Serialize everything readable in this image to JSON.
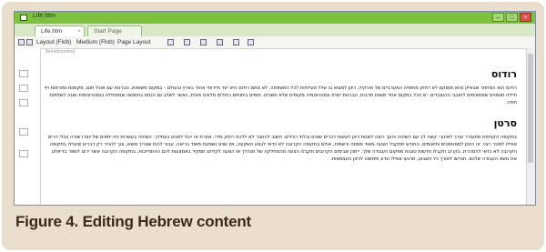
{
  "window": {
    "title": "Life.htm",
    "controls": {
      "minimize": "–",
      "maximize": "□",
      "close": "×"
    }
  },
  "tabs": [
    {
      "label": "Life.htm",
      "close": "×"
    },
    {
      "label": "Start Page"
    }
  ],
  "toolbar": {
    "layout": "Layout (Flob)",
    "size": "Medium (Flob)",
    "page_layout": "Page Layout"
  },
  "breadcrumb": "[breadcrumbs]",
  "document": {
    "heading1": "רודוס",
    "para1": "רודוס הוא המחוזר שבאייון והוא ממוקם לא רחוק מחופיה המערביים של טורקיה. כיוון למצוא בו שלל פעילויות לכל המשפחה. לא סתם רודוס היא יעד תיירותי אהוד בארץ ובעולם - במקום משופות, טברנות עם אוכל חום, מקומות ומורמות ויוי חיילה תוסטים שמתאימים לחובבי ההעובדים. יש הכל במקום אחד משנת תרבות, טברנות יוונית וגסטרונומיה מקומית שלא תשכחו. חופים ביתוחים כחולים מלווים ויוונית, נאשר לשלב גם הנחת בחופשה שמתחילה בגסטרונומית ושנה לשלמות חוויה.",
    "heading2": "סרטן",
    "para2": "בתקופה הקודמת מתעורר עורך לאינוך: קשה לך עם השיטה והעך רוצה לשנות כיוון לעשות דברים שונים ובלתי רגילים. חשוב להתבר לא ללכת רחוק מידי, אחרת זה יכול לפגוע בעתידך. השיטה בעשרות הזו יחסים של יוצרו שורה ובולי הרים אפילו למטר רצוי. זה הזמן לסמטפטים ותיאומים. החודש תתקבל הצעה מאוד מפתה ורשמית, אולם בתקופה הקרובה לא כדאי לבצע השקעה, אין שוים נשמעת מאוד בריאה, עבור לכות שצריך מוצא, צוך להכיר רק דברים שיובילו בתקופה הקרובה לא כדאי להמהרת. בקרוב תקבלו חדשות טובות מפקום העבודה שלך, ייתכן שבימים הקרובים תקבלו הצעה מהמחלקה של מנהלך או הצעה לקידום תפקיד באמצעות לכם ההתחייבות, בתקופה הקרובה אשר ירצו לשפר בדיאלוג את נושא העבודה שלכם. תנרשו לאורך כל השבוע, תרגעו אפילו ונדע תימשכו לכיוון העצמאות."
  },
  "caption": "Figure 4. Editing Hebrew content",
  "colors": {
    "titlebar": "#7ec13e",
    "frame": "#eadfcf",
    "caption": "#3b2a1c"
  }
}
